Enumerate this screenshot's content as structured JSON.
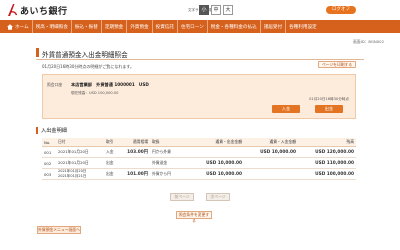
{
  "header": {
    "bank_name": "あいち銀行",
    "font_size_label": "文字サイズ変更",
    "font_sizes": [
      "小",
      "中",
      "大"
    ],
    "logout_label": "ログオフ"
  },
  "nav": {
    "items": [
      "ホーム",
      "残高・明細照会",
      "振込・振替",
      "定期預金",
      "外貨預金",
      "投資信託",
      "住宅ローン",
      "税金・各種料金の払込",
      "諸届受付",
      "各種利用設定"
    ]
  },
  "screen_id": "画面ID：BGN002",
  "page_title": "外貨普通預金入出金明細照会",
  "info_text": "01月20日16時30分時点の明細がご覧になれます。",
  "print_label": "ページを印刷する",
  "account": {
    "label": "照会口座",
    "name_line": "本店営業部　外貨普通 1000001　USD",
    "balance_line": "現在残高：USD 100,000.00",
    "btn_deposit": "入金",
    "btn_withdraw": "出金",
    "time": "01月20日16時30分時点"
  },
  "section_title": "入出金明細",
  "table": {
    "headers": [
      "No.",
      "日付",
      "取引",
      "適用相場",
      "取扱",
      "通貨・出金金額",
      "通貨・入金金額",
      "残高"
    ],
    "rows": [
      {
        "no": "001",
        "date": "2021年01月20日",
        "txn": "入金",
        "rate": "103.00円",
        "note": "円から外貨",
        "out": "",
        "in": "USD 10,000.00",
        "bal": "USD 120,000.00"
      },
      {
        "no": "002",
        "date": "2021年01月20日",
        "txn": "出金",
        "rate": "",
        "note": "外貨送金",
        "out": "USD 10,000.00",
        "in": "",
        "bal": "USD 110,000.00"
      },
      {
        "no": "003",
        "date": "2021年01月20日",
        "date2": "2021年01月21日",
        "txn": "出金",
        "rate": "101.00円",
        "note": "外貨から円",
        "out": "USD 10,000.00",
        "in": "",
        "bal": "USD 100,000.00"
      }
    ]
  },
  "pager": {
    "prev": "前ページ",
    "next": "次ページ"
  },
  "change_conditions": "照会条件を変更する",
  "back_button": "外貨預金メニュー画面へ",
  "colors": {
    "accent": "#d6611c",
    "button": "#e27423",
    "panel": "#fdebdc"
  }
}
